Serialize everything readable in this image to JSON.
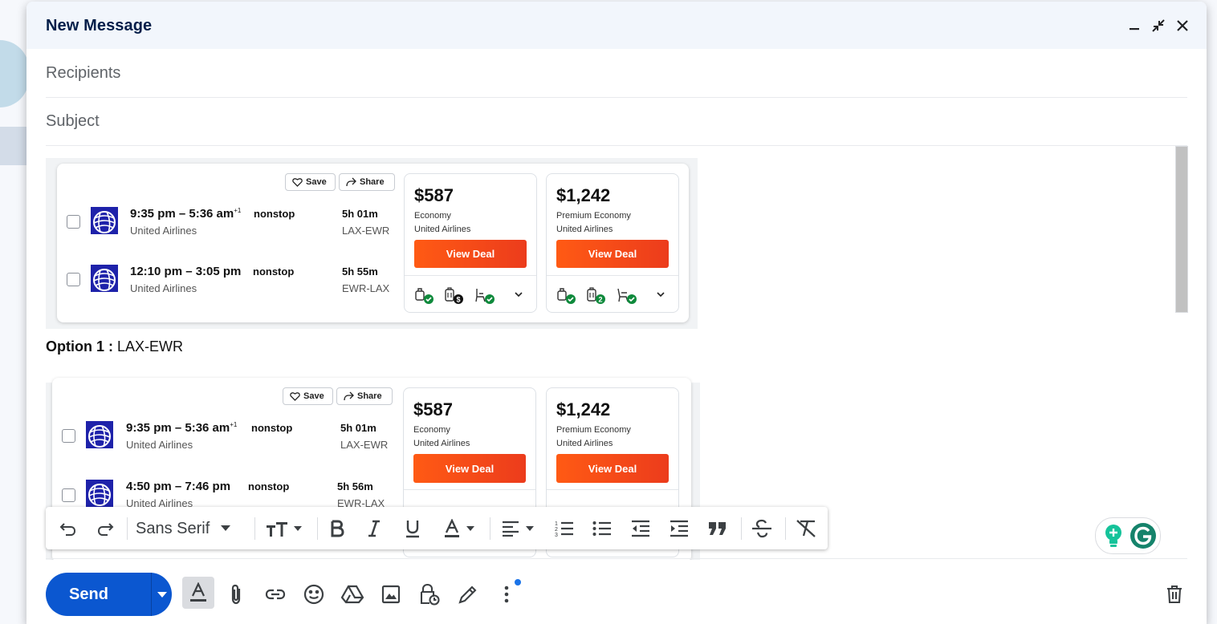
{
  "window": {
    "title": "New Message"
  },
  "fields": {
    "recipients_placeholder": "Recipients",
    "subject_placeholder": "Subject"
  },
  "flight_shot_1": {
    "save_label": "Save",
    "share_label": "Share",
    "rows": [
      {
        "times": "9:35 pm – 5:36 am",
        "plus_day": "+1",
        "airline": "United Airlines",
        "stops": "nonstop",
        "duration": "5h 01m",
        "route": "LAX-EWR"
      },
      {
        "times": "12:10 pm – 3:05 pm",
        "plus_day": "",
        "airline": "United Airlines",
        "stops": "nonstop",
        "duration": "5h 55m",
        "route": "EWR-LAX"
      }
    ],
    "prices": [
      {
        "price": "$587",
        "cabin": "Economy",
        "airline": "United Airlines",
        "button": "View Deal",
        "bag_badge": "$"
      },
      {
        "price": "$1,242",
        "cabin": "Premium Economy",
        "airline": "United Airlines",
        "button": "View Deal",
        "bag_badge": "2"
      }
    ]
  },
  "option_line": {
    "label": "Option 1 :",
    "value": " LAX-EWR"
  },
  "flight_shot_2": {
    "save_label": "Save",
    "share_label": "Share",
    "rows": [
      {
        "times": "9:35 pm – 5:36 am",
        "plus_day": "+1",
        "airline": "United Airlines",
        "stops": "nonstop",
        "duration": "5h 01m",
        "route": "LAX-EWR"
      },
      {
        "times": "4:50 pm – 7:46 pm",
        "plus_day": "",
        "airline": "United Airlines",
        "stops": "nonstop",
        "duration": "5h 56m",
        "route": "EWR-LAX"
      }
    ],
    "prices": [
      {
        "price": "$587",
        "cabin": "Economy",
        "airline": "United Airlines",
        "button": "View Deal"
      },
      {
        "price": "$1,242",
        "cabin": "Premium Economy",
        "airline": "United Airlines",
        "button": "View Deal"
      }
    ]
  },
  "toolbar": {
    "font_family": "Sans Serif"
  },
  "footer": {
    "send_label": "Send"
  },
  "colors": {
    "accent": "#0b57d0",
    "deal_orange": "#ff5a14",
    "check_green": "#0f8a3c",
    "header_bg": "#f2f6fc"
  },
  "icons": [
    "minimize-icon",
    "exit-fullscreen-icon",
    "close-icon",
    "undo-icon",
    "redo-icon",
    "text-size-icon",
    "bold-icon",
    "italic-icon",
    "underline-icon",
    "text-color-icon",
    "align-icon",
    "numbered-list-icon",
    "bulleted-list-icon",
    "indent-less-icon",
    "indent-more-icon",
    "quote-icon",
    "strikethrough-icon",
    "remove-formatting-icon",
    "formatting-options-icon",
    "attach-icon",
    "link-icon",
    "emoji-icon",
    "drive-icon",
    "photo-icon",
    "confidential-icon",
    "signature-icon",
    "more-options-icon",
    "trash-icon",
    "grammarly-icon"
  ]
}
